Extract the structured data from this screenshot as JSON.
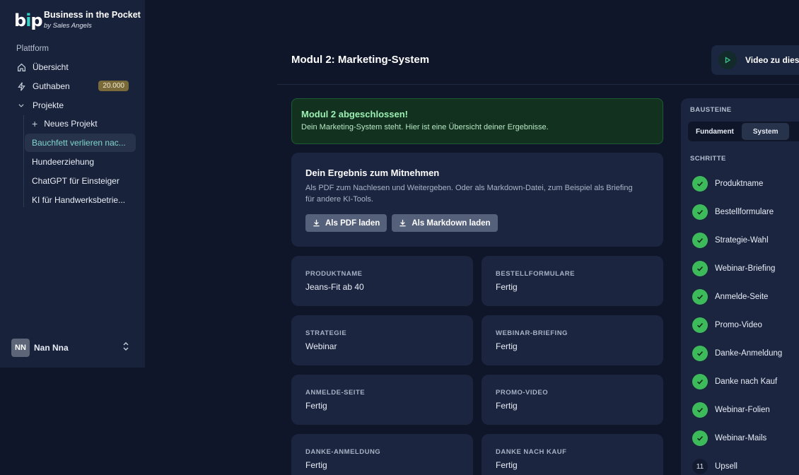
{
  "brand": {
    "logo_text": "bip",
    "title": "Business in the Pocket",
    "subtitle": "by Sales Angels"
  },
  "sidebar": {
    "section_label": "Plattform",
    "items": [
      {
        "label": "Übersicht",
        "icon": "home-icon"
      },
      {
        "label": "Guthaben",
        "icon": "lightning-icon",
        "badge": "20.000"
      },
      {
        "label": "Projekte",
        "icon": "chevron-down-icon"
      }
    ],
    "projects": [
      {
        "label": "Neues Projekt",
        "icon": "plus-icon"
      },
      {
        "label": "Bauchfett verlieren nac...",
        "active": true
      },
      {
        "label": "Hundeerziehung"
      },
      {
        "label": "ChatGPT für Einsteiger"
      },
      {
        "label": "KI für Handwerksbetrie..."
      }
    ],
    "user": {
      "initials": "NN",
      "name": "Nan Nna"
    }
  },
  "header": {
    "title": "Modul 2: Marketing-System",
    "video_label": "Video zu diese"
  },
  "success": {
    "title": "Modul 2 abgeschlossen!",
    "text": "Dein Marketing-System steht. Hier ist eine Übersicht deiner Ergebnisse."
  },
  "result": {
    "title": "Dein Ergebnis zum Mitnehmen",
    "text": "Als PDF zum Nachlesen und Weitergeben. Oder als Markdown-Datei, zum Beispiel als Briefing für andere KI-Tools.",
    "pdf_label": "Als PDF laden",
    "md_label": "Als Markdown laden"
  },
  "info_cards": [
    {
      "label": "PRODUKTNAME",
      "value": "Jeans-Fit ab 40"
    },
    {
      "label": "BESTELLFORMULARE",
      "value": "Fertig"
    },
    {
      "label": "STRATEGIE",
      "value": "Webinar"
    },
    {
      "label": "WEBINAR-BRIEFING",
      "value": "Fertig"
    },
    {
      "label": "ANMELDE-SEITE",
      "value": "Fertig"
    },
    {
      "label": "PROMO-VIDEO",
      "value": "Fertig"
    },
    {
      "label": "DANKE-ANMELDUNG",
      "value": "Fertig"
    },
    {
      "label": "DANKE NACH KAUF",
      "value": "Fertig"
    }
  ],
  "panel": {
    "bausteine_label": "BAUSTEINE",
    "tabs": [
      {
        "label": "Fundament"
      },
      {
        "label": "System",
        "active": true
      }
    ],
    "schritte_label": "SCHRITTE",
    "steps": [
      {
        "label": "Produktname",
        "done": true
      },
      {
        "label": "Bestellformulare",
        "done": true
      },
      {
        "label": "Strategie-Wahl",
        "done": true
      },
      {
        "label": "Webinar-Briefing",
        "done": true
      },
      {
        "label": "Anmelde-Seite",
        "done": true
      },
      {
        "label": "Promo-Video",
        "done": true
      },
      {
        "label": "Danke-Anmeldung",
        "done": true
      },
      {
        "label": "Danke nach Kauf",
        "done": true
      },
      {
        "label": "Webinar-Folien",
        "done": true
      },
      {
        "label": "Webinar-Mails",
        "done": true
      },
      {
        "label": "Upsell",
        "done": false,
        "number": "11"
      }
    ]
  },
  "colors": {
    "accent_teal": "#38d1c6",
    "success_green": "#3dbb5a",
    "badge_gold": "#7a6a3a"
  }
}
